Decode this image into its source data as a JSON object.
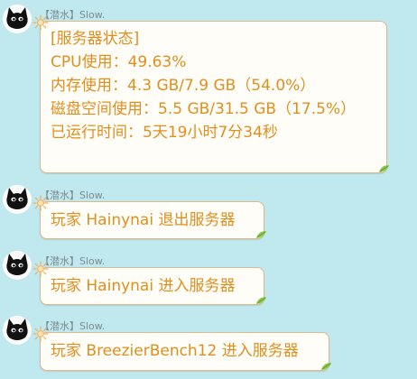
{
  "messages": [
    {
      "sender": "【潜水】Slow.",
      "lines": [
        "[服务器状态]",
        "CPU使用：49.63%",
        "内存使用：4.3 GB/7.9 GB（54.0%）",
        "磁盘空间使用：5.5 GB/31.5 GB（17.5%）",
        "已运行时间：5天19小时7分34秒"
      ]
    },
    {
      "sender": "【潜水】Slow.",
      "lines": [
        "玩家 Hainynai 退出服务器"
      ]
    },
    {
      "sender": "【潜水】Slow.",
      "lines": [
        "玩家 Hainynai 进入服务器"
      ]
    },
    {
      "sender": "【潜水】Slow.",
      "lines": [
        "玩家 BreezierBench12 进入服务器"
      ]
    }
  ],
  "colors": {
    "background": "#bfe8ef",
    "bubble_text": "#e08f1e",
    "bubble_border": "#ddb98c",
    "bubble_fill": "#fffdf8",
    "sender_text": "#7e8b91"
  },
  "icons": {
    "avatar": "black-cat-avatar-icon",
    "bubble_top_left": "sun-decoration-icon",
    "bubble_bottom_right": "leaf-decoration-icon"
  }
}
